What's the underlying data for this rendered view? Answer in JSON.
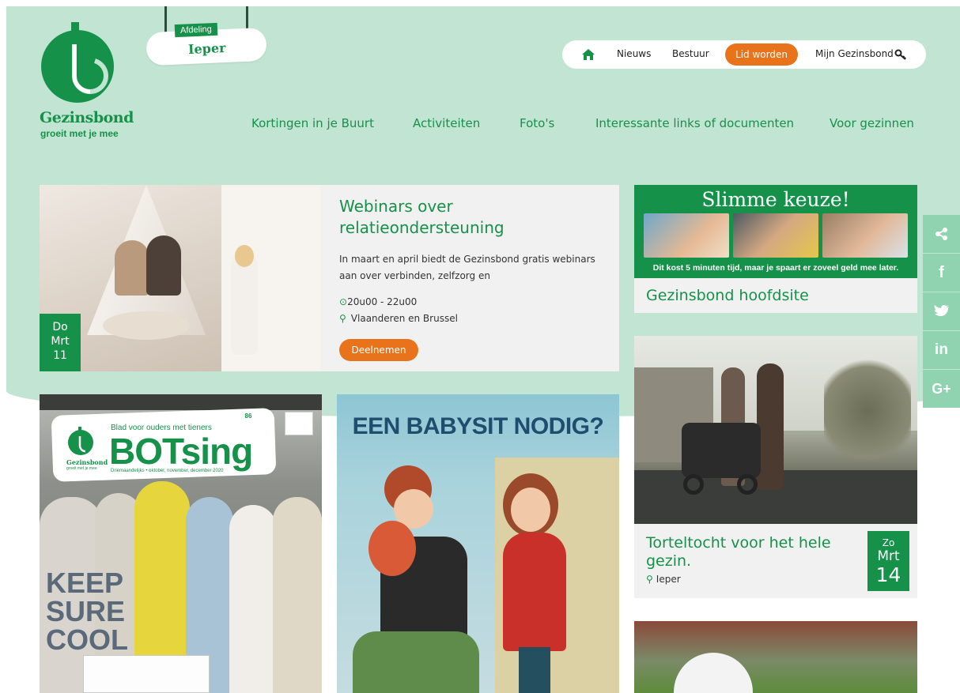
{
  "brand": {
    "name": "Gezinsbond",
    "tagline": "groeit met je mee",
    "colors": {
      "green": "#16914a",
      "mint": "#c2e4d3",
      "orange": "#e8731a"
    }
  },
  "afdeling": {
    "label": "Afdeling",
    "city": "Ieper"
  },
  "topnav": {
    "home_icon": "home-icon",
    "links": [
      "Nieuws",
      "Bestuur"
    ],
    "cta": "Lid worden",
    "account": "Mijn Gezinsbond",
    "account_icon": "key-icon"
  },
  "mainnav": [
    "Kortingen in je Buurt",
    "Activiteiten",
    "Foto's",
    "Interessante links of documenten",
    "Voor gezinnen"
  ],
  "featured": {
    "date": {
      "day": "Do",
      "month": "Mrt",
      "num": "11"
    },
    "title": "Webinars over relatieondersteuning",
    "description": "In maart en april biedt de Gezinsbond gratis webinars aan over verbinden, zelfzorg en",
    "time": "20u00 - 22u00",
    "location": "Vlaanderen en Brussel",
    "button": "Deelnemen"
  },
  "slimme": {
    "title": "Slimme keuze!",
    "subtitle": "Dit kost 5 minuten tijd, maar je spaart er zoveel geld mee later.",
    "link": "Gezinsbond hoofdsite"
  },
  "tortel": {
    "title": "Torteltocht voor het hele gezin.",
    "location": "Ieper",
    "date": {
      "day": "Zo",
      "month": "Mrt",
      "num": "14"
    }
  },
  "botsing": {
    "issue": "86",
    "subtitle": "Blad voor ouders met tieners",
    "title": "BOTsing",
    "edition": "Driemaandelijks • oktober, november, december 2020",
    "logo_name": "Gezinsbond",
    "logo_tag": "groeit met je mee",
    "shirt": "KEEP SURE COOL"
  },
  "babysit": {
    "title": "EEN BABYSIT NODIG?"
  },
  "social": [
    "share-icon",
    "facebook-icon",
    "twitter-icon",
    "linkedin-icon",
    "googleplus-icon"
  ]
}
